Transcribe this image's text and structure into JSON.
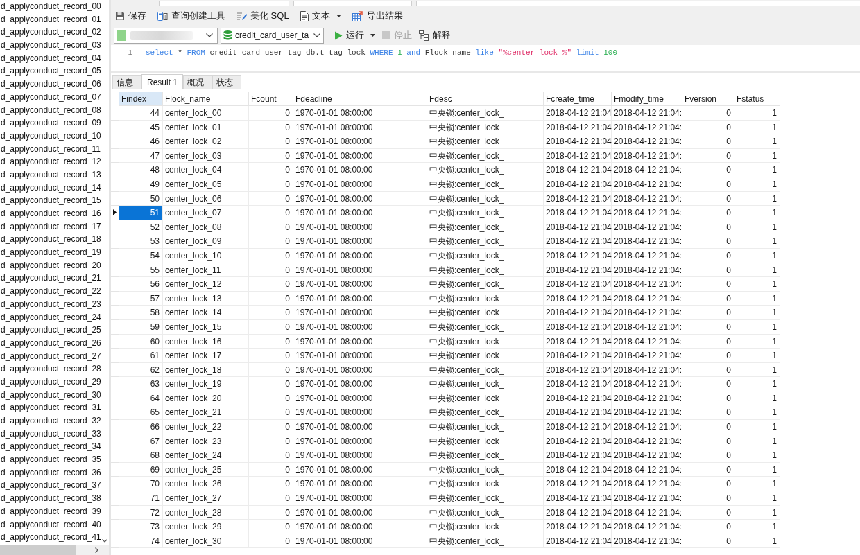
{
  "sidebar": {
    "items": [
      "d_applyconduct_record_00",
      "d_applyconduct_record_01",
      "d_applyconduct_record_02",
      "d_applyconduct_record_03",
      "d_applyconduct_record_04",
      "d_applyconduct_record_05",
      "d_applyconduct_record_06",
      "d_applyconduct_record_07",
      "d_applyconduct_record_08",
      "d_applyconduct_record_09",
      "d_applyconduct_record_10",
      "d_applyconduct_record_11",
      "d_applyconduct_record_12",
      "d_applyconduct_record_13",
      "d_applyconduct_record_14",
      "d_applyconduct_record_15",
      "d_applyconduct_record_16",
      "d_applyconduct_record_17",
      "d_applyconduct_record_18",
      "d_applyconduct_record_19",
      "d_applyconduct_record_20",
      "d_applyconduct_record_21",
      "d_applyconduct_record_22",
      "d_applyconduct_record_23",
      "d_applyconduct_record_24",
      "d_applyconduct_record_25",
      "d_applyconduct_record_26",
      "d_applyconduct_record_27",
      "d_applyconduct_record_28",
      "d_applyconduct_record_29",
      "d_applyconduct_record_30",
      "d_applyconduct_record_31",
      "d_applyconduct_record_32",
      "d_applyconduct_record_33",
      "d_applyconduct_record_34",
      "d_applyconduct_record_35",
      "d_applyconduct_record_36",
      "d_applyconduct_record_37",
      "d_applyconduct_record_38",
      "d_applyconduct_record_39",
      "d_applyconduct_record_40",
      "d_applyconduct_record_41"
    ]
  },
  "toolbar": {
    "buttons": [
      {
        "kind": "save",
        "label": "保存",
        "dropdown": false
      },
      {
        "kind": "query_builder",
        "label": "查询创建工具",
        "dropdown": false
      },
      {
        "kind": "beautify",
        "label": "美化 SQL",
        "dropdown": false
      },
      {
        "kind": "text",
        "label": "文本",
        "dropdown": true
      },
      {
        "kind": "export",
        "label": "导出结果",
        "dropdown": false
      }
    ]
  },
  "run_bar": {
    "database": {
      "value": "credit_card_user_ta"
    },
    "buttons": [
      {
        "kind": "run",
        "label": "运行",
        "dropdown": true,
        "disabled": false
      },
      {
        "kind": "stop",
        "label": "停止",
        "dropdown": false,
        "disabled": true
      },
      {
        "kind": "explain",
        "label": "解释",
        "dropdown": false,
        "disabled": false
      }
    ]
  },
  "editor": {
    "lines": [
      {
        "number": "1",
        "tokens": [
          {
            "kind": "keyword",
            "text": "select"
          },
          {
            "kind": "plain",
            "text": "*"
          },
          {
            "kind": "keyword",
            "text": "FROM"
          },
          {
            "kind": "plain",
            "text": "credit_card_user_tag_db.t_tag_lock"
          },
          {
            "kind": "keyword",
            "text": "WHERE"
          },
          {
            "kind": "number",
            "text": "1"
          },
          {
            "kind": "keyword",
            "text": "and"
          },
          {
            "kind": "plain",
            "text": "Flock_name"
          },
          {
            "kind": "keyword",
            "text": "like"
          },
          {
            "kind": "string",
            "text": "\"%center_lock_%\""
          },
          {
            "kind": "keyword",
            "text": "limit"
          },
          {
            "kind": "number",
            "text": "100"
          }
        ]
      }
    ]
  },
  "result_tabs": [
    {
      "label": "信息",
      "selected": false
    },
    {
      "label": "Result 1",
      "selected": true
    },
    {
      "label": "概况",
      "selected": false
    },
    {
      "label": "状态",
      "selected": false
    }
  ],
  "table": {
    "columns": [
      {
        "label": "Findex",
        "kind": "number",
        "selected": true
      },
      {
        "label": "Flock_name",
        "kind": "text",
        "selected": false
      },
      {
        "label": "Fcount",
        "kind": "number",
        "selected": false
      },
      {
        "label": "Fdeadline",
        "kind": "text",
        "selected": false
      },
      {
        "label": "Fdesc",
        "kind": "text",
        "selected": false
      },
      {
        "label": "Fcreate_time",
        "kind": "text",
        "selected": false
      },
      {
        "label": "Fmodify_time",
        "kind": "text",
        "selected": false
      },
      {
        "label": "Fversion",
        "kind": "number",
        "selected": false
      },
      {
        "label": "Fstatus",
        "kind": "number",
        "selected": false
      }
    ],
    "rows": [
      {
        "selected": false,
        "cells": [
          "44",
          "center_lock_00",
          "0",
          "1970-01-01 08:00:00",
          "中央锁:center_lock_",
          "2018-04-12 21:04",
          "2018-04-12 21:04:",
          "0",
          "1"
        ]
      },
      {
        "selected": false,
        "cells": [
          "45",
          "center_lock_01",
          "0",
          "1970-01-01 08:00:00",
          "中央锁:center_lock_",
          "2018-04-12 21:04",
          "2018-04-12 21:04:",
          "0",
          "1"
        ]
      },
      {
        "selected": false,
        "cells": [
          "46",
          "center_lock_02",
          "0",
          "1970-01-01 08:00:00",
          "中央锁:center_lock_",
          "2018-04-12 21:04",
          "2018-04-12 21:04:",
          "0",
          "1"
        ]
      },
      {
        "selected": false,
        "cells": [
          "47",
          "center_lock_03",
          "0",
          "1970-01-01 08:00:00",
          "中央锁:center_lock_",
          "2018-04-12 21:04",
          "2018-04-12 21:04:",
          "0",
          "1"
        ]
      },
      {
        "selected": false,
        "cells": [
          "48",
          "center_lock_04",
          "0",
          "1970-01-01 08:00:00",
          "中央锁:center_lock_",
          "2018-04-12 21:04",
          "2018-04-12 21:04:",
          "0",
          "1"
        ]
      },
      {
        "selected": false,
        "cells": [
          "49",
          "center_lock_05",
          "0",
          "1970-01-01 08:00:00",
          "中央锁:center_lock_",
          "2018-04-12 21:04",
          "2018-04-12 21:04:",
          "0",
          "1"
        ]
      },
      {
        "selected": false,
        "cells": [
          "50",
          "center_lock_06",
          "0",
          "1970-01-01 08:00:00",
          "中央锁:center_lock_",
          "2018-04-12 21:04",
          "2018-04-12 21:04:",
          "0",
          "1"
        ]
      },
      {
        "selected": true,
        "cells": [
          "51",
          "center_lock_07",
          "0",
          "1970-01-01 08:00:00",
          "中央锁:center_lock_",
          "2018-04-12 21:04",
          "2018-04-12 21:04:",
          "0",
          "1"
        ]
      },
      {
        "selected": false,
        "cells": [
          "52",
          "center_lock_08",
          "0",
          "1970-01-01 08:00:00",
          "中央锁:center_lock_",
          "2018-04-12 21:04",
          "2018-04-12 21:04:",
          "0",
          "1"
        ]
      },
      {
        "selected": false,
        "cells": [
          "53",
          "center_lock_09",
          "0",
          "1970-01-01 08:00:00",
          "中央锁:center_lock_",
          "2018-04-12 21:04",
          "2018-04-12 21:04:",
          "0",
          "1"
        ]
      },
      {
        "selected": false,
        "cells": [
          "54",
          "center_lock_10",
          "0",
          "1970-01-01 08:00:00",
          "中央锁:center_lock_",
          "2018-04-12 21:04",
          "2018-04-12 21:04:",
          "0",
          "1"
        ]
      },
      {
        "selected": false,
        "cells": [
          "55",
          "center_lock_11",
          "0",
          "1970-01-01 08:00:00",
          "中央锁:center_lock_",
          "2018-04-12 21:04",
          "2018-04-12 21:04:",
          "0",
          "1"
        ]
      },
      {
        "selected": false,
        "cells": [
          "56",
          "center_lock_12",
          "0",
          "1970-01-01 08:00:00",
          "中央锁:center_lock_",
          "2018-04-12 21:04",
          "2018-04-12 21:04:",
          "0",
          "1"
        ]
      },
      {
        "selected": false,
        "cells": [
          "57",
          "center_lock_13",
          "0",
          "1970-01-01 08:00:00",
          "中央锁:center_lock_",
          "2018-04-12 21:04",
          "2018-04-12 21:04:",
          "0",
          "1"
        ]
      },
      {
        "selected": false,
        "cells": [
          "58",
          "center_lock_14",
          "0",
          "1970-01-01 08:00:00",
          "中央锁:center_lock_",
          "2018-04-12 21:04",
          "2018-04-12 21:04:",
          "0",
          "1"
        ]
      },
      {
        "selected": false,
        "cells": [
          "59",
          "center_lock_15",
          "0",
          "1970-01-01 08:00:00",
          "中央锁:center_lock_",
          "2018-04-12 21:04",
          "2018-04-12 21:04:",
          "0",
          "1"
        ]
      },
      {
        "selected": false,
        "cells": [
          "60",
          "center_lock_16",
          "0",
          "1970-01-01 08:00:00",
          "中央锁:center_lock_",
          "2018-04-12 21:04",
          "2018-04-12 21:04:",
          "0",
          "1"
        ]
      },
      {
        "selected": false,
        "cells": [
          "61",
          "center_lock_17",
          "0",
          "1970-01-01 08:00:00",
          "中央锁:center_lock_",
          "2018-04-12 21:04",
          "2018-04-12 21:04:",
          "0",
          "1"
        ]
      },
      {
        "selected": false,
        "cells": [
          "62",
          "center_lock_18",
          "0",
          "1970-01-01 08:00:00",
          "中央锁:center_lock_",
          "2018-04-12 21:04",
          "2018-04-12 21:04:",
          "0",
          "1"
        ]
      },
      {
        "selected": false,
        "cells": [
          "63",
          "center_lock_19",
          "0",
          "1970-01-01 08:00:00",
          "中央锁:center_lock_",
          "2018-04-12 21:04",
          "2018-04-12 21:04:",
          "0",
          "1"
        ]
      },
      {
        "selected": false,
        "cells": [
          "64",
          "center_lock_20",
          "0",
          "1970-01-01 08:00:00",
          "中央锁:center_lock_",
          "2018-04-12 21:04",
          "2018-04-12 21:04:",
          "0",
          "1"
        ]
      },
      {
        "selected": false,
        "cells": [
          "65",
          "center_lock_21",
          "0",
          "1970-01-01 08:00:00",
          "中央锁:center_lock_",
          "2018-04-12 21:04",
          "2018-04-12 21:04:",
          "0",
          "1"
        ]
      },
      {
        "selected": false,
        "cells": [
          "66",
          "center_lock_22",
          "0",
          "1970-01-01 08:00:00",
          "中央锁:center_lock_",
          "2018-04-12 21:04",
          "2018-04-12 21:04:",
          "0",
          "1"
        ]
      },
      {
        "selected": false,
        "cells": [
          "67",
          "center_lock_23",
          "0",
          "1970-01-01 08:00:00",
          "中央锁:center_lock_",
          "2018-04-12 21:04",
          "2018-04-12 21:04:",
          "0",
          "1"
        ]
      },
      {
        "selected": false,
        "cells": [
          "68",
          "center_lock_24",
          "0",
          "1970-01-01 08:00:00",
          "中央锁:center_lock_",
          "2018-04-12 21:04",
          "2018-04-12 21:04:",
          "0",
          "1"
        ]
      },
      {
        "selected": false,
        "cells": [
          "69",
          "center_lock_25",
          "0",
          "1970-01-01 08:00:00",
          "中央锁:center_lock_",
          "2018-04-12 21:04",
          "2018-04-12 21:04:",
          "0",
          "1"
        ]
      },
      {
        "selected": false,
        "cells": [
          "70",
          "center_lock_26",
          "0",
          "1970-01-01 08:00:00",
          "中央锁:center_lock_",
          "2018-04-12 21:04",
          "2018-04-12 21:04:",
          "0",
          "1"
        ]
      },
      {
        "selected": false,
        "cells": [
          "71",
          "center_lock_27",
          "0",
          "1970-01-01 08:00:00",
          "中央锁:center_lock_",
          "2018-04-12 21:04",
          "2018-04-12 21:04:",
          "0",
          "1"
        ]
      },
      {
        "selected": false,
        "cells": [
          "72",
          "center_lock_28",
          "0",
          "1970-01-01 08:00:00",
          "中央锁:center_lock_",
          "2018-04-12 21:04",
          "2018-04-12 21:04:",
          "0",
          "1"
        ]
      },
      {
        "selected": false,
        "cells": [
          "73",
          "center_lock_29",
          "0",
          "1970-01-01 08:00:00",
          "中央锁:center_lock_",
          "2018-04-12 21:04",
          "2018-04-12 21:04:",
          "0",
          "1"
        ]
      },
      {
        "selected": false,
        "cells": [
          "74",
          "center_lock_30",
          "0",
          "1970-01-01 08:00:00",
          "中央锁:center_lock_",
          "2018-04-12 21:04",
          "2018-04-12 21:04:",
          "0",
          "1"
        ]
      }
    ]
  }
}
